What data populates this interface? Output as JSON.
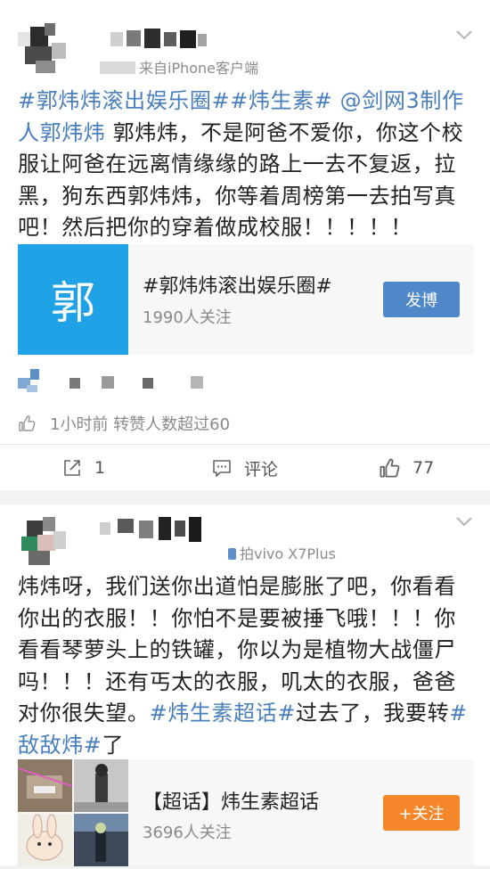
{
  "colors": {
    "link_blue": "#4a7fbd",
    "button_blue": "#4f87c8",
    "button_orange": "#f6862a",
    "topic_thumb_blue": "#1fa3e6"
  },
  "post1": {
    "source": "来自iPhone客户端",
    "hashtag_1": "#郭炜炜滚出娱乐圈#",
    "hashtag_2": "#炜生素#",
    "mention": "@剑网3制作人郭炜炜",
    "body": "郭炜炜，不是阿爸不爱你，你这个校服让阿爸在远离情缘缘的路上一去不复返，拉黑，狗东西郭炜炜，你等着周榜第一去拍写真吧！然后把你的穿着做成校服！！！！！",
    "topic": {
      "thumb_char": "郭",
      "title": "#郭炜炜滚出娱乐圈#",
      "followers": "1990人关注",
      "button": "发博"
    },
    "meta": "1小时前  转赞人数超过60",
    "actions": {
      "repost_count": "1",
      "comment_label": "评论",
      "like_count": "77"
    },
    "icons": [
      "chevron-down-icon",
      "like-icon",
      "repost-icon",
      "comment-icon"
    ]
  },
  "post2": {
    "source": "拍vivo X7Plus",
    "body_start": "炜炜呀，我们送你出道怕是膨胀了吧，你看看你出的衣服！！你怕不是要被捶飞哦！！！你看看琴萝头上的铁罐，你以为是植物大战僵尸吗！！！还有丐太的衣服，叽太的衣服，爸爸对你很失望。",
    "hashtag_1": "#炜生素超话#",
    "body_mid": "过去了，我要转",
    "hashtag_2": "#敌敌炜#",
    "body_end": "了",
    "topic": {
      "title": "【超话】炜生素超话",
      "followers": "3696人关注",
      "button": "+关注"
    }
  }
}
